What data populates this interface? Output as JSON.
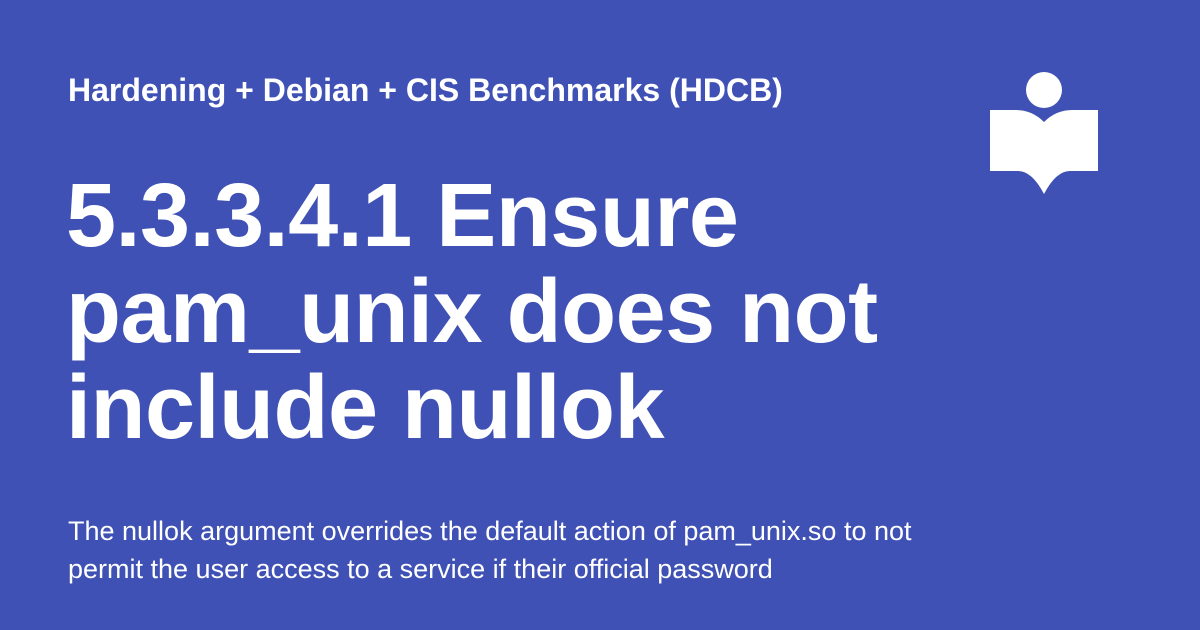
{
  "header": {
    "site_name": "Hardening + Debian + CIS Benchmarks (HDCB)",
    "logo_icon": "reader-book-icon"
  },
  "main": {
    "title": "5.3.3.4.1 Ensure pam_unix does not include nullok",
    "description": "The nullok argument overrides the default action of pam_unix.so to not permit the user access to a service if their official password"
  },
  "colors": {
    "background": "#3f51b5",
    "foreground": "#ffffff"
  }
}
